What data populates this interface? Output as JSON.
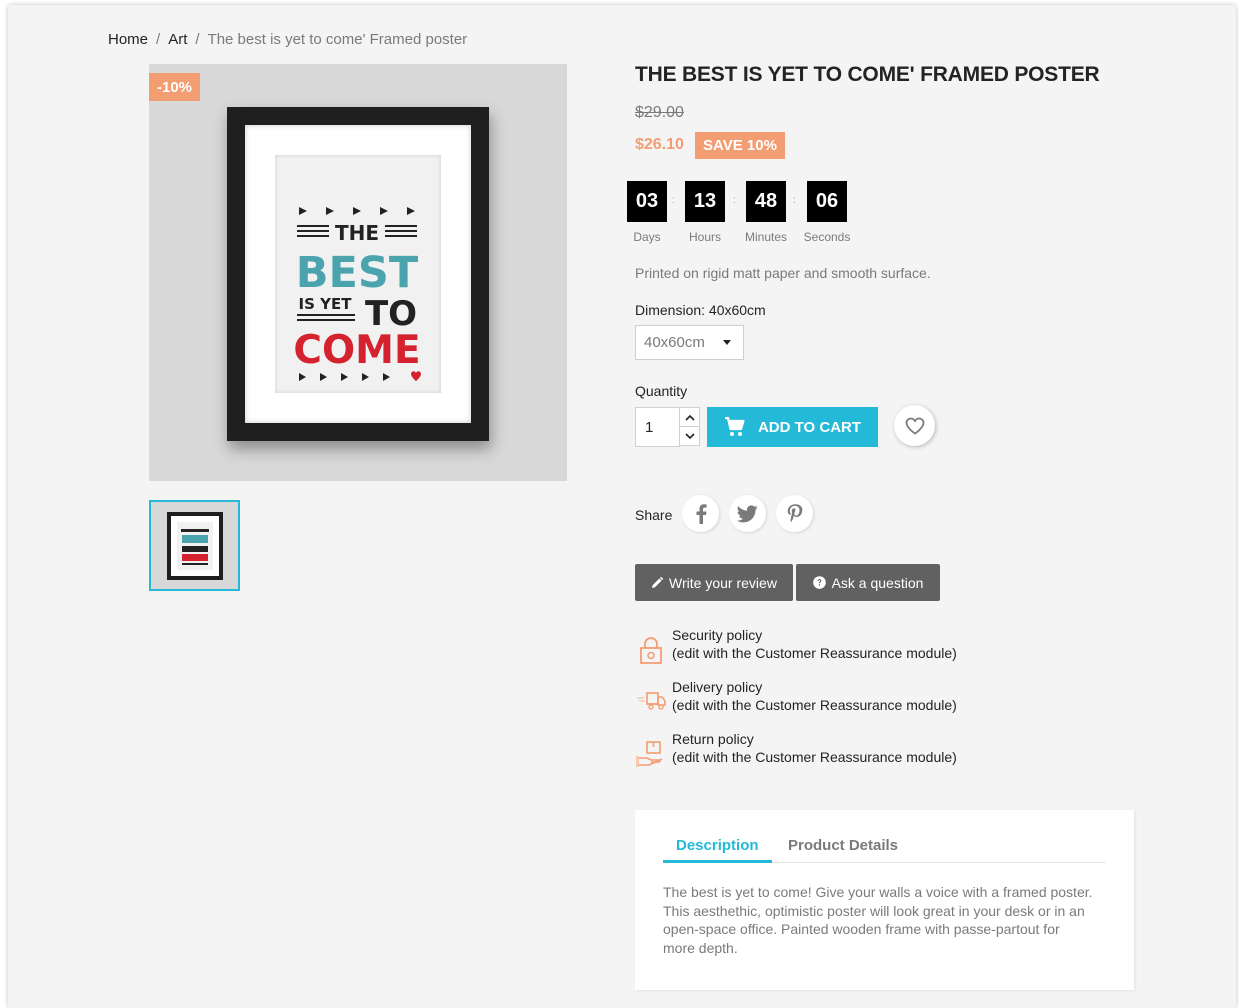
{
  "breadcrumb": {
    "home": "Home",
    "category": "Art",
    "current": "The best is yet to come' Framed poster"
  },
  "product": {
    "discount_badge": "-10%",
    "title": "THE BEST IS YET TO COME' FRAMED POSTER",
    "old_price": "$29.00",
    "new_price": "$26.10",
    "save_badge": "SAVE 10%",
    "short_description": "Printed on rigid matt paper and smooth surface.",
    "poster_text": {
      "line1": "THE",
      "line2": "BEST",
      "line3a": "IS YET",
      "line3b": "TO",
      "line4": "COME"
    }
  },
  "countdown": [
    {
      "value": "03",
      "label": "Days"
    },
    {
      "value": "13",
      "label": "Hours"
    },
    {
      "value": "48",
      "label": "Minutes"
    },
    {
      "value": "06",
      "label": "Seconds"
    }
  ],
  "dimension": {
    "label": "Dimension: 40x60cm",
    "selected": "40x60cm"
  },
  "quantity": {
    "label": "Quantity",
    "value": "1"
  },
  "actions": {
    "add_to_cart": "ADD TO CART",
    "share_label": "Share",
    "write_review": "Write your review",
    "ask_question": "Ask a question"
  },
  "reassurance": [
    {
      "title": "Security policy",
      "subtitle": "(edit with the Customer Reassurance module)"
    },
    {
      "title": "Delivery policy",
      "subtitle": "(edit with the Customer Reassurance module)"
    },
    {
      "title": "Return policy",
      "subtitle": "(edit with the Customer Reassurance module)"
    }
  ],
  "tabs": {
    "items": [
      {
        "label": "Description"
      },
      {
        "label": "Product Details"
      }
    ],
    "description": "The best is yet to come! Give your walls a voice with a framed poster. This aesthethic, optimistic poster will look great in your desk or in an open-space office. Painted wooden frame with passe-partout for more depth."
  },
  "colors": {
    "accent": "#24b9d7",
    "discount": "#f39d72",
    "dark_button": "#616161",
    "poster_teal": "#4aa3ad",
    "poster_red": "#d4232f"
  },
  "icons": {
    "cart": "shopping-cart-icon",
    "wishlist": "heart-outline-icon",
    "facebook": "facebook-icon",
    "twitter": "twitter-icon",
    "pinterest": "pinterest-icon",
    "review": "pencil-icon",
    "question": "question-circle-icon",
    "security": "lock-icon",
    "delivery": "truck-icon",
    "return": "return-package-icon"
  }
}
